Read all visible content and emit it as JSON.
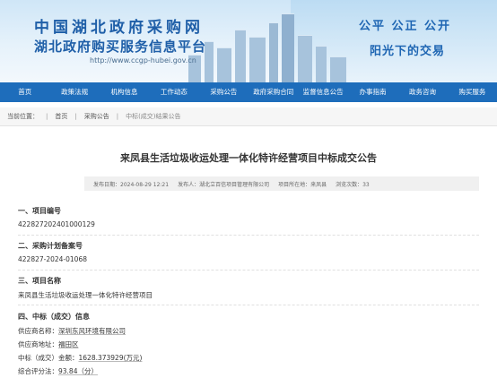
{
  "header": {
    "title": "中国湖北政府采购网",
    "subtitle": "湖北政府购买服务信息平台",
    "url": "http://www.ccgp-hubei.gov.cn",
    "slogan_line1": "公平 公正 公开",
    "slogan_line2": "阳光下的交易"
  },
  "nav": {
    "items": [
      "首页",
      "政策法规",
      "机构信息",
      "工作动态",
      "采购公告",
      "政府采购合同",
      "监督信息公告",
      "办事指南",
      "政务咨询",
      "购买服务"
    ]
  },
  "breadcrumb": {
    "label": "当前位置：",
    "home": "首页",
    "section": "采购公告",
    "current": "中标(成交)结果公告"
  },
  "announcement": {
    "title": "来凤县生活垃圾收运处理一体化特许经营项目中标成交公告",
    "publish_time": "发布日期：2024-08-29 12:21",
    "agency": "发布人：湖北立百信项目管理有限公司",
    "region": "项目所在地：来凤县",
    "views": "浏览次数：33"
  },
  "sections": {
    "project_no_title": "一、项目编号",
    "project_no": "422827202401000129",
    "plan_no_title": "二、采购计划备案号",
    "plan_no": "422827-2024-01068",
    "project_name_title": "三、项目名称",
    "project_name": "来凤县生活垃圾收运处理一体化特许经营项目",
    "winner_title": "四、中标（成交）信息",
    "supplier_name_label": "供应商名称：",
    "supplier_name": "深圳东风环境有限公司",
    "supplier_addr_label": "供应商地址：",
    "supplier_addr": "福田区",
    "amount_label": "中标（成交）金额：",
    "amount": "1628.373929(万元)",
    "score_label": "综合评分法：",
    "score": "93.84（分）"
  }
}
